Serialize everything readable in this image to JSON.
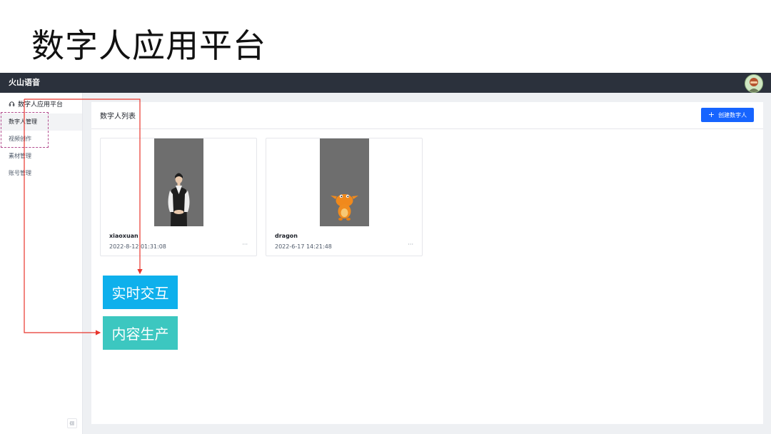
{
  "slide": {
    "title": "数字人应用平台"
  },
  "topbar": {
    "brand": "火山语音"
  },
  "sidebar": {
    "header": "数字人应用平台",
    "items": [
      {
        "label": "数字人管理",
        "active": true
      },
      {
        "label": "视频创作",
        "active": false
      },
      {
        "label": "素材管理",
        "active": false
      },
      {
        "label": "账号管理",
        "active": false
      }
    ]
  },
  "panel": {
    "title": "数字人列表",
    "create_label": "创建数字人"
  },
  "cards": [
    {
      "name": "xiaoxuan",
      "date": "2022-8-12 01:31:08",
      "more": "···"
    },
    {
      "name": "dragon",
      "date": "2022-6-17 14:21:48",
      "more": "···"
    }
  ],
  "annotations": {
    "tag_realtime": "实时交互",
    "tag_content": "内容生产"
  },
  "colors": {
    "topbar": "#2b313c",
    "accent": "#1664ff",
    "annotation_arrow": "#e8352c",
    "tag_realtime_bg": "#0eb0ec",
    "tag_content_bg": "#3cc7c0"
  }
}
